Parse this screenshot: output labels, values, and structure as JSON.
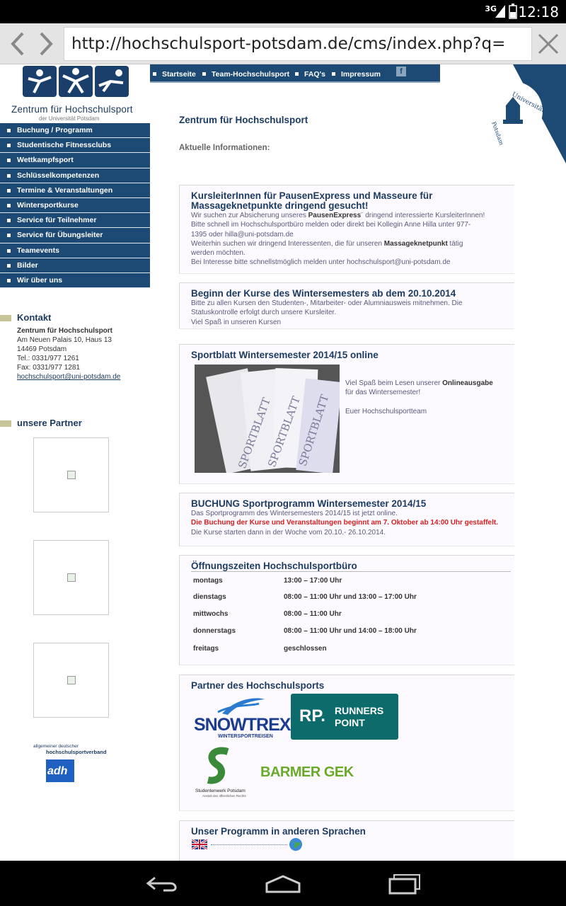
{
  "status": {
    "signal": "3G",
    "time": "12:18"
  },
  "browser": {
    "url": "http://hochschulsport-potsdam.de/cms/index.php?q="
  },
  "site": {
    "logo_title": "Zentrum für Hochschulsport",
    "logo_sub": "der Universität Potsdam",
    "topnav": [
      "Startseite",
      "Team-Hochschulsport",
      "FAQ's",
      "Impressum"
    ],
    "fb": "f",
    "uni_seal": {
      "arc_text": "Universität",
      "side_text": "Potsdam"
    },
    "sidemenu": [
      "Buchung / Programm",
      "Studentische Fitnessclubs",
      "Wettkampfsport",
      "Schlüsselkompetenzen",
      "Termine & Veranstaltungen",
      "Wintersportkurse",
      "Service für Teilnehmer",
      "Service für Übungsleiter",
      "Teamevents",
      "Bilder",
      "Wir über uns"
    ],
    "kontakt": {
      "heading": "Kontakt",
      "name": "Zentrum für Hochschulsport",
      "address1": "Am Neuen Palais 10, Haus 13",
      "address2": "14469 Potsdam",
      "tel": "Tel.: 0331/977 1261",
      "fax": "Fax: 0331/977 1281",
      "email": "hochschulsport@uni-potsdam.de"
    },
    "partner_heading": "unsere Partner",
    "adh": {
      "line1": "allgemeiner deutscher",
      "line2": "hochschulsportverband",
      "mark": "adh"
    },
    "main_title": "Zentrum für Hochschulsport",
    "main_sub": "Aktuelle Informationen:",
    "news": [
      {
        "title": "KursleiterInnen für PausenExpress und Masseure für Massageknetpunkte dringend gesucht!",
        "l1a": "Wir suchen zur Absicherung unseres ",
        "l1b": "PausenExpress",
        "l1c": "¨ dringend interessierte KursleiterInnen!",
        "l2": "Bitte schnell im Hochschulsportbüro melden oder direkt bei Kollegin Anne Hilla unter 977-",
        "l3": "1395 oder hilla@uni-potsdam.de",
        "l4a": "Weiterhin suchen wir  dringend Interessenten, die für unseren ",
        "l4b": "Massageknetpunkt",
        "l4c": " tätig",
        "l5": "werden möchten.",
        "l6": "Bei Interesse bitte schnellstmöglich melden unter hochschulsport@uni-potsdam.de"
      },
      {
        "title": "Beginn der Kurse des Wintersemesters ab dem 20.10.2014",
        "l1": "Bitte zu allen Kursen den Studenten-, Mitarbeiter- oder Alumniausweis mitnehmen. Die",
        "l2": "Statuskontrolle erfolgt durch unsere Kursleiter.",
        "l3": "Viel Spaß in unseren Kursen"
      },
      {
        "title": "Sportblatt Wintersemester 2014/15 online",
        "l1a": "Viel Spaß beim Lesen unserer ",
        "l1b": "Onlineausgabe",
        "l2": "für das Wintersemester!",
        "l3": "Euer Hochschulsportteam",
        "image_text": "SPORTBLATT"
      },
      {
        "title": "BUCHUNG Sportprogramm Wintersemester 2014/15",
        "l1": "Das Sportprogramm des Wintersemesters 2014/15 ist jetzt online.",
        "l2": "Die Buchung der Kurse und Veranstaltungen beginnt am 7. Oktober ab 14:00 Uhr gestaffelt.",
        "l3": "Die Kurse starten dann in der Woche vom 20.10.- 26.10.2014."
      }
    ],
    "hours": {
      "title": "Öffnungszeiten Hochschulsportbüro",
      "rows": [
        {
          "day": "montags",
          "time": "13:00 – 17:00 Uhr"
        },
        {
          "day": "dienstags",
          "time": "08:00 – 11:00 Uhr und 13:00 – 17:00 Uhr"
        },
        {
          "day": "mittwochs",
          "time": "08:00 – 11:00 Uhr"
        },
        {
          "day": "donnerstags",
          "time": "08:00 – 11:00 Uhr und 14:00 – 18:00 Uhr"
        },
        {
          "day": "freitags",
          "time": "geschlossen"
        }
      ]
    },
    "partners": {
      "title": "Partner des Hochschulsports",
      "snowtrex": "SNOWTREX",
      "snowtrex_sub": "WINTERSPORTREISEN",
      "runners1": "RUNNERS",
      "runners2": "POINT",
      "runners_mark": "RP.",
      "studentenwerk": "Studentenwerk Potsdam",
      "studentenwerk_sub": "Anstalt des öffentlichen Rechts",
      "barmer": "BARMER GEK"
    },
    "languages": {
      "title": "Unser Programm in anderen Sprachen"
    }
  }
}
